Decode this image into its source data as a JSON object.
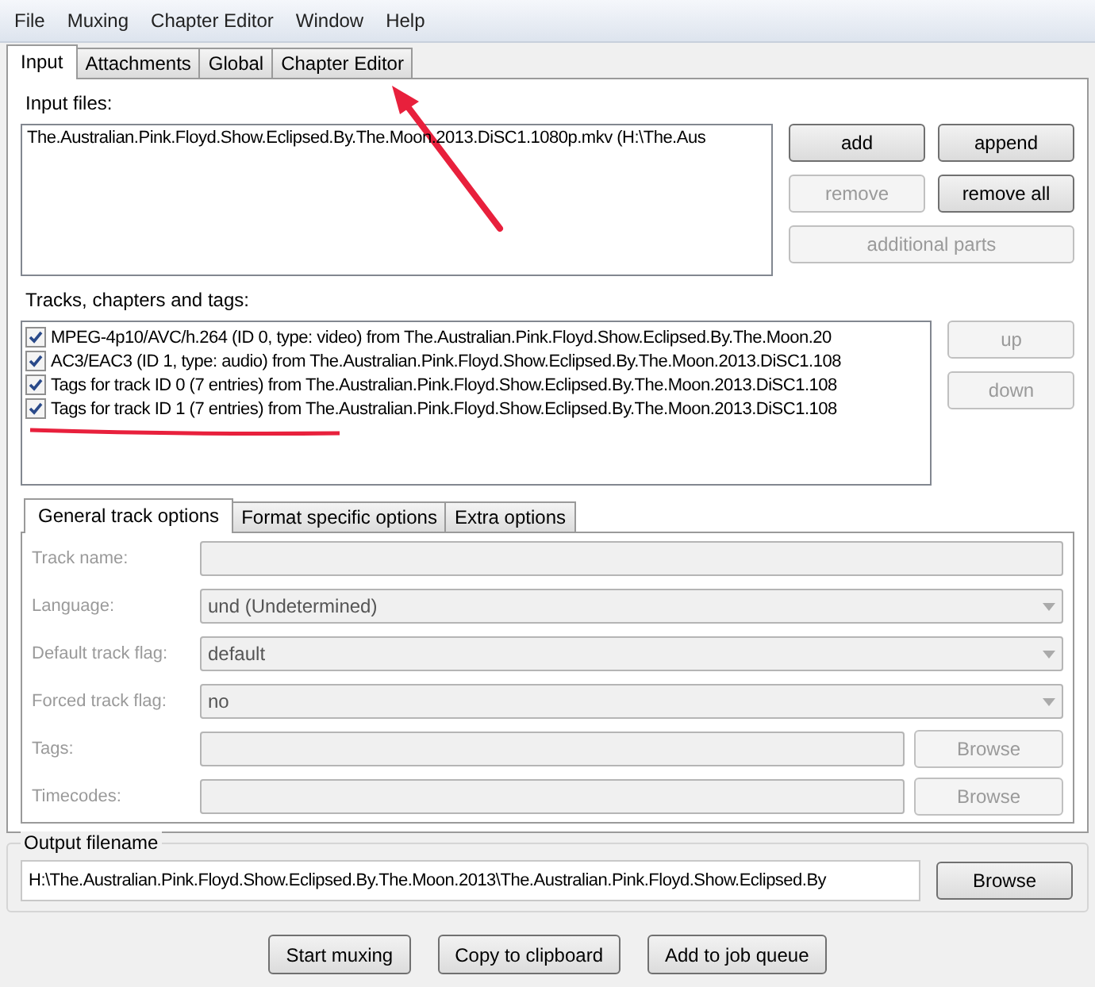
{
  "menu": [
    "File",
    "Muxing",
    "Chapter Editor",
    "Window",
    "Help"
  ],
  "tabs": [
    {
      "label": "Input",
      "selected": true
    },
    {
      "label": "Attachments",
      "selected": false
    },
    {
      "label": "Global",
      "selected": false
    },
    {
      "label": "Chapter Editor",
      "selected": false
    }
  ],
  "input_files": {
    "label": "Input files:",
    "files": [
      "The.Australian.Pink.Floyd.Show.Eclipsed.By.The.Moon.2013.DiSC1.1080p.mkv (H:\\The.Aus"
    ],
    "buttons": [
      {
        "label": "add",
        "disabled": false
      },
      {
        "label": "append",
        "disabled": false
      },
      {
        "label": "remove",
        "disabled": true
      },
      {
        "label": "remove all",
        "disabled": false
      },
      {
        "label": "additional parts",
        "disabled": true
      }
    ]
  },
  "tracks": {
    "label": "Tracks, chapters and tags:",
    "items": [
      {
        "text": "MPEG-4p10/AVC/h.264 (ID 0, type: video) from The.Australian.Pink.Floyd.Show.Eclipsed.By.The.Moon.20",
        "checked": true
      },
      {
        "text": "AC3/EAC3 (ID 1, type: audio) from The.Australian.Pink.Floyd.Show.Eclipsed.By.The.Moon.2013.DiSC1.108",
        "checked": true
      },
      {
        "text": "Tags for track ID 0 (7 entries) from The.Australian.Pink.Floyd.Show.Eclipsed.By.The.Moon.2013.DiSC1.108",
        "checked": true
      },
      {
        "text": "Tags for track ID 1 (7 entries) from The.Australian.Pink.Floyd.Show.Eclipsed.By.The.Moon.2013.DiSC1.108",
        "checked": true
      }
    ],
    "buttons": [
      {
        "label": "up",
        "disabled": true
      },
      {
        "label": "down",
        "disabled": true
      }
    ]
  },
  "option_tabs": [
    {
      "label": "General track options",
      "selected": true
    },
    {
      "label": "Format specific options",
      "selected": false
    },
    {
      "label": "Extra options",
      "selected": false
    }
  ],
  "options": [
    {
      "kind": "text",
      "label": "Track name:",
      "disabled": true
    },
    {
      "kind": "dropdown",
      "label": "Language:",
      "value": "und (Undetermined)",
      "disabled": true
    },
    {
      "kind": "dropdown",
      "label": "Default track flag:",
      "value": "default",
      "disabled": true
    },
    {
      "kind": "dropdown",
      "label": "Forced track flag:",
      "value": "no",
      "disabled": true
    },
    {
      "kind": "file",
      "label": "Tags:",
      "button": "Browse",
      "disabled": true
    },
    {
      "kind": "file",
      "label": "Timecodes:",
      "button": "Browse",
      "disabled": true
    }
  ],
  "output": {
    "label": "Output filename",
    "value": "H:\\The.Australian.Pink.Floyd.Show.Eclipsed.By.The.Moon.2013\\The.Australian.Pink.Floyd.Show.Eclipsed.By",
    "button": "Browse"
  },
  "actions": [
    "Start muxing",
    "Copy to clipboard",
    "Add to job queue"
  ]
}
